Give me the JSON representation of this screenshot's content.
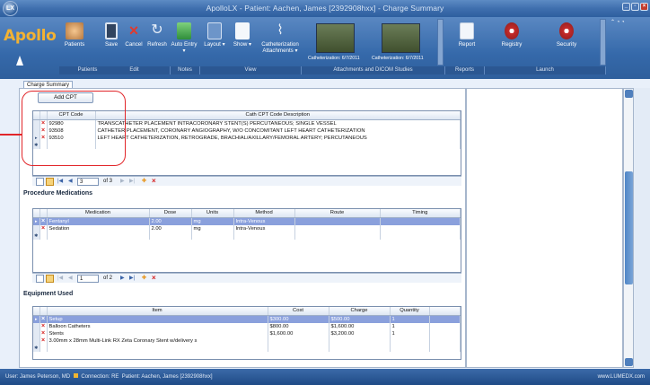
{
  "window": {
    "title": "ApolloLX - Patient: Aachen, James [2392908hxx] - Charge Summary"
  },
  "ribbon": {
    "app_name": "Apollo",
    "buttons": [
      {
        "label": "Patients",
        "icon": "patients-icon"
      },
      {
        "label": "Save",
        "icon": "save-icon"
      },
      {
        "label": "Cancel",
        "icon": "cancel-icon"
      },
      {
        "label": "Refresh",
        "icon": "refresh-icon"
      },
      {
        "label": "Auto Entry",
        "icon": "auto-entry-icon"
      },
      {
        "label": "Layout",
        "icon": "layout-icon"
      },
      {
        "label": "Show",
        "icon": "show-icon"
      },
      {
        "label": "Catheterization Attachments",
        "icon": "paperclip-icon"
      },
      {
        "label": "Report",
        "icon": "report-icon"
      },
      {
        "label": "Registry",
        "icon": "registry-icon"
      },
      {
        "label": "Security",
        "icon": "security-icon"
      }
    ],
    "studies": [
      "Catheterization: 6/7/2011",
      "Catheterization: 6/7/2011"
    ],
    "groups": [
      "Patients",
      "Edit",
      "Notes",
      "View",
      "Attachments and DICOM Studies",
      "Reports",
      "Launch"
    ]
  },
  "tab": "Charge Summary",
  "cpt": {
    "add_label": "Add CPT",
    "columns": [
      "CPT Code",
      "Cath CPT Code Description"
    ],
    "rows": [
      {
        "code": "92980",
        "desc": "TRANSCATHETER PLACEMENT INTRACORONARY STENT(S) PERCUTANEOUS; SINGLE VESSEL"
      },
      {
        "code": "93508",
        "desc": "CATHETER PLACEMENT, CORONARY ANGIOGRAPHY, W/O CONCOMITANT LEFT HEART CATHETERIZATION"
      },
      {
        "code": "93510",
        "desc": "LEFT HEART CATHETERIZATION, RETROGRADE, BRACHIAL/AXILLARY/FEMORAL ARTERY; PERCUTANEOUS"
      }
    ],
    "page": "3",
    "of": "of 3"
  },
  "medications": {
    "title": "Procedure Medications",
    "columns": [
      "Medication",
      "Dose",
      "Units",
      "Method",
      "Route",
      "Timing"
    ],
    "rows": [
      {
        "medication": "Fentanyl",
        "dose": "2.00",
        "units": "mg",
        "method": "Intra-Venous",
        "route": "",
        "timing": ""
      },
      {
        "medication": "Sedation",
        "dose": "2.00",
        "units": "mg",
        "method": "Intra-Venous",
        "route": "",
        "timing": ""
      }
    ],
    "page": "1",
    "of": "of 2"
  },
  "equipment": {
    "title": "Equipment Used",
    "columns": [
      "Item",
      "Cost",
      "Charge",
      "Quantity"
    ],
    "rows": [
      {
        "item": "Setup",
        "cost": "$300.00",
        "charge": "$500.00",
        "qty": "1"
      },
      {
        "item": "Balloon Catheters",
        "cost": "$800.00",
        "charge": "$1,600.00",
        "qty": "1"
      },
      {
        "item": "Stents",
        "cost": "$1,600.00",
        "charge": "$3,200.00",
        "qty": "1"
      },
      {
        "item": "3.00mm x 28mm Multi-Link RX Zeta Coronary Stent w/delivery s",
        "cost": "",
        "charge": "",
        "qty": ""
      }
    ]
  },
  "status": {
    "user": "User: James Peterson, MD",
    "connection": "Connection: RE",
    "patient": "Patient: Aachen, James [2392908hxx]",
    "watermark": "www.LUMEDX.com"
  }
}
